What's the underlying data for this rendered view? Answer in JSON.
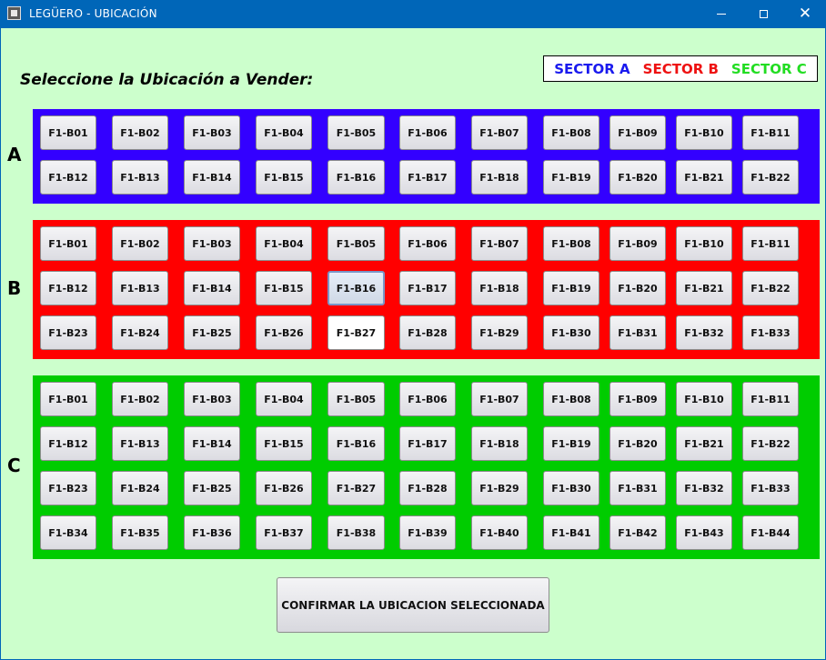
{
  "window": {
    "title": "LEGÜERO - UBICACIÓN",
    "icon": "app-icon"
  },
  "prompt": "Seleccione la Ubicación a Vender:",
  "legend": [
    {
      "label": "SECTOR A",
      "color": "#1a1aee"
    },
    {
      "label": "SECTOR B",
      "color": "#ee1111"
    },
    {
      "label": "SECTOR C",
      "color": "#22dd22"
    }
  ],
  "sectors": [
    {
      "letter": "A",
      "color": "#3300ff",
      "seats": [
        "F1-B01",
        "F1-B02",
        "F1-B03",
        "F1-B04",
        "F1-B05",
        "F1-B06",
        "F1-B07",
        "F1-B08",
        "F1-B09",
        "F1-B10",
        "F1-B11",
        "F1-B12",
        "F1-B13",
        "F1-B14",
        "F1-B15",
        "F1-B16",
        "F1-B17",
        "F1-B18",
        "F1-B19",
        "F1-B20",
        "F1-B21",
        "F1-B22"
      ]
    },
    {
      "letter": "B",
      "color": "#ff0000",
      "seats": [
        "F1-B01",
        "F1-B02",
        "F1-B03",
        "F1-B04",
        "F1-B05",
        "F1-B06",
        "F1-B07",
        "F1-B08",
        "F1-B09",
        "F1-B10",
        "F1-B11",
        "F1-B12",
        "F1-B13",
        "F1-B14",
        "F1-B15",
        "F1-B16",
        "F1-B17",
        "F1-B18",
        "F1-B19",
        "F1-B20",
        "F1-B21",
        "F1-B22",
        "F1-B23",
        "F1-B24",
        "F1-B25",
        "F1-B26",
        "F1-B27",
        "F1-B28",
        "F1-B29",
        "F1-B30",
        "F1-B31",
        "F1-B32",
        "F1-B33"
      ],
      "focused_seat": "F1-B16",
      "highlighted_seat": "F1-B27"
    },
    {
      "letter": "C",
      "color": "#00cc00",
      "seats": [
        "F1-B01",
        "F1-B02",
        "F1-B03",
        "F1-B04",
        "F1-B05",
        "F1-B06",
        "F1-B07",
        "F1-B08",
        "F1-B09",
        "F1-B10",
        "F1-B11",
        "F1-B12",
        "F1-B13",
        "F1-B14",
        "F1-B15",
        "F1-B16",
        "F1-B17",
        "F1-B18",
        "F1-B19",
        "F1-B20",
        "F1-B21",
        "F1-B22",
        "F1-B23",
        "F1-B24",
        "F1-B25",
        "F1-B26",
        "F1-B27",
        "F1-B28",
        "F1-B29",
        "F1-B30",
        "F1-B31",
        "F1-B32",
        "F1-B33",
        "F1-B34",
        "F1-B35",
        "F1-B36",
        "F1-B37",
        "F1-B38",
        "F1-B39",
        "F1-B40",
        "F1-B41",
        "F1-B42",
        "F1-B43",
        "F1-B44"
      ]
    }
  ],
  "confirm_label": "CONFIRMAR LA UBICACION SELECCIONADA"
}
